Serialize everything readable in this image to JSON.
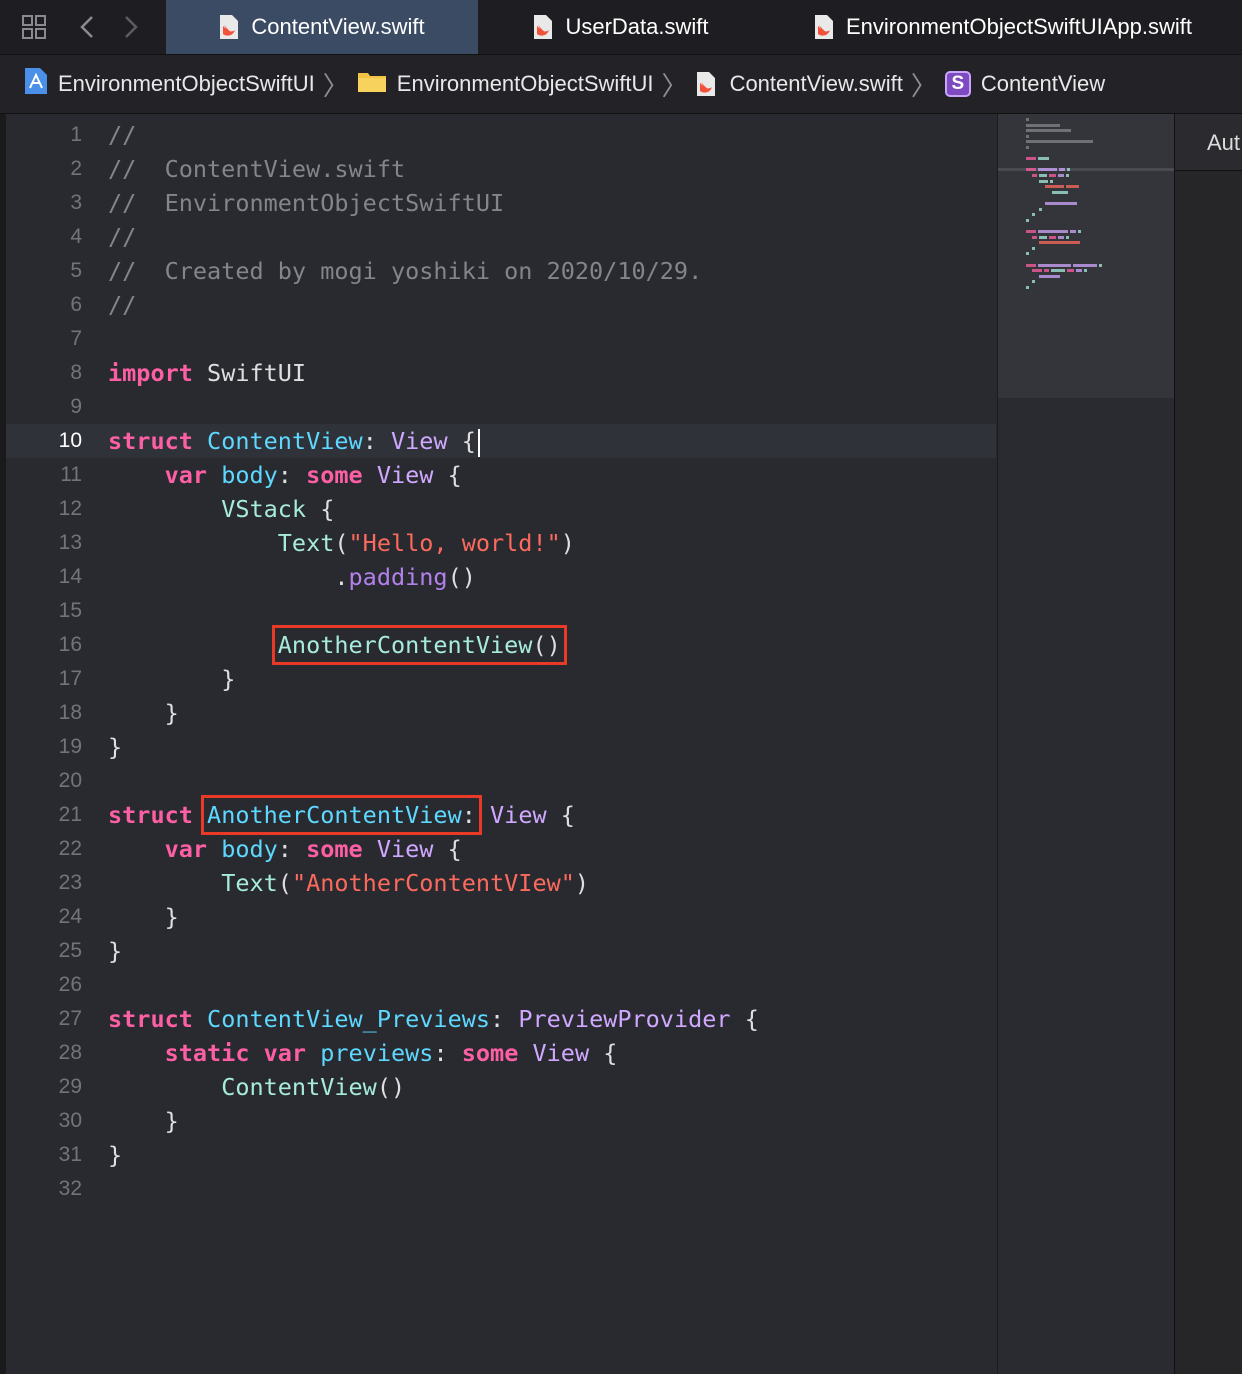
{
  "tabs": [
    {
      "label": "ContentView.swift",
      "active": true
    },
    {
      "label": "UserData.swift",
      "active": false
    },
    {
      "label": "EnvironmentObjectSwiftUIApp.swift",
      "active": false
    }
  ],
  "breadcrumb": {
    "project": "EnvironmentObjectSwiftUI",
    "folder": "EnvironmentObjectSwiftUI",
    "file": "ContentView.swift",
    "symbol_badge": "S",
    "symbol": "ContentView"
  },
  "right_pane": {
    "label": "Aut"
  },
  "editor": {
    "current_line": "10",
    "lines": [
      {
        "n": "1",
        "t": "//"
      },
      {
        "n": "2",
        "t": "//  ContentView.swift"
      },
      {
        "n": "3",
        "t": "//  EnvironmentObjectSwiftUI"
      },
      {
        "n": "4",
        "t": "//"
      },
      {
        "n": "5",
        "t": "//  Created by mogi yoshiki on 2020/10/29."
      },
      {
        "n": "6",
        "t": "//"
      },
      {
        "n": "7",
        "t": ""
      },
      {
        "n": "8",
        "t": "import SwiftUI"
      },
      {
        "n": "9",
        "t": ""
      },
      {
        "n": "10",
        "t": "struct ContentView: View {"
      },
      {
        "n": "11",
        "t": "    var body: some View {"
      },
      {
        "n": "12",
        "t": "        VStack {"
      },
      {
        "n": "13",
        "t": "            Text(\"Hello, world!\")"
      },
      {
        "n": "14",
        "t": "                .padding()"
      },
      {
        "n": "15",
        "t": ""
      },
      {
        "n": "16",
        "t": "            AnotherContentView()"
      },
      {
        "n": "17",
        "t": "        }"
      },
      {
        "n": "18",
        "t": "    }"
      },
      {
        "n": "19",
        "t": "}"
      },
      {
        "n": "20",
        "t": ""
      },
      {
        "n": "21",
        "t": "struct AnotherContentView: View {"
      },
      {
        "n": "22",
        "t": "    var body: some View {"
      },
      {
        "n": "23",
        "t": "        Text(\"AnotherContentVIew\")"
      },
      {
        "n": "24",
        "t": "    }"
      },
      {
        "n": "25",
        "t": "}"
      },
      {
        "n": "26",
        "t": ""
      },
      {
        "n": "27",
        "t": "struct ContentView_Previews: PreviewProvider {"
      },
      {
        "n": "28",
        "t": "    static var previews: some View {"
      },
      {
        "n": "29",
        "t": "        ContentView()"
      },
      {
        "n": "30",
        "t": "    }"
      },
      {
        "n": "31",
        "t": "}"
      },
      {
        "n": "32",
        "t": ""
      }
    ]
  },
  "colors": {
    "keyword": "#fc5fa3",
    "type_decl": "#5dd8ff",
    "type_ref": "#d0a8ff",
    "function": "#a7ebdd",
    "property": "#b281eb",
    "string": "#fc6a5d",
    "comment": "#84858a",
    "highlight_box": "#e83a26"
  }
}
